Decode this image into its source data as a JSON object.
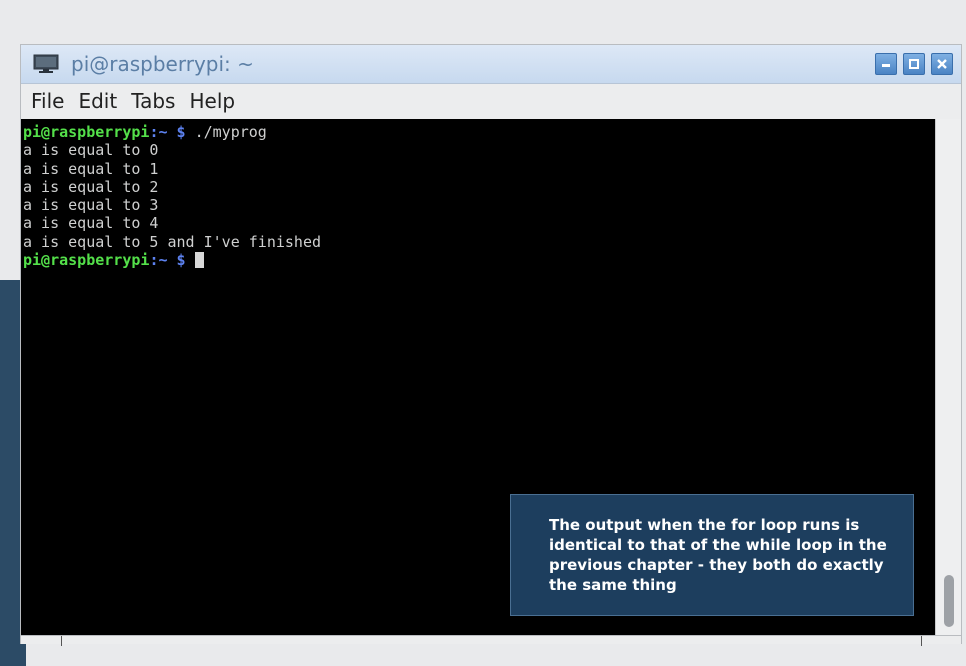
{
  "window": {
    "title": "pi@raspberrypi: ~",
    "buttons": {
      "minimize": "minimize",
      "maximize": "maximize",
      "close": "close"
    }
  },
  "menubar": {
    "items": [
      "File",
      "Edit",
      "Tabs",
      "Help"
    ]
  },
  "terminal": {
    "prompt_user": "pi@raspberrypi",
    "prompt_path": ":~ $",
    "command": " ./myprog",
    "output": [
      "a is equal to 0",
      "a is equal to 1",
      "a is equal to 2",
      "a is equal to 3",
      "a is equal to 4",
      "a is equal to 5 and I've finished"
    ]
  },
  "callout": {
    "text": "The output when the for loop runs is identical to that of the while loop in the previous chapter - they both do exactly the same thing"
  },
  "colors": {
    "prompt_user": "#54e04a",
    "prompt_path": "#5d82f0",
    "terminal_bg": "#000000",
    "title_text": "#5b7ea5",
    "callout_bg": "#1d3e5e"
  },
  "icons": {
    "title": "terminal-monitor-icon",
    "minimize": "minimize-icon",
    "maximize": "maximize-icon",
    "close": "close-icon"
  }
}
